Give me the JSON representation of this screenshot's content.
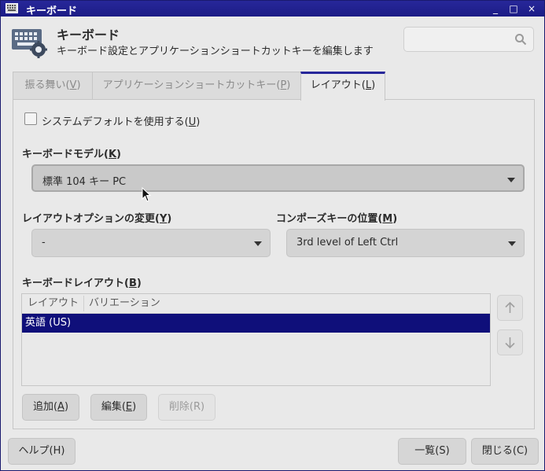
{
  "window": {
    "title": "キーボード",
    "buttons": [
      "_",
      "□",
      "×"
    ]
  },
  "header": {
    "title": "キーボード",
    "subtitle": "キーボード設定とアプリケーションショートカットキーを編集します",
    "icon": "keyboard-settings-icon"
  },
  "search": {
    "placeholder": ""
  },
  "tabs": [
    {
      "label": "振る舞い(",
      "mnemonic": "V",
      "tail": ")"
    },
    {
      "label": "アプリケーションショートカットキー(",
      "mnemonic": "P",
      "tail": ")"
    },
    {
      "label": "レイアウト(",
      "mnemonic": "L",
      "tail": ")"
    }
  ],
  "active_tab": 2,
  "system_default": {
    "label": "システムデフォルトを使用する(",
    "mnemonic": "U",
    "tail": ")",
    "checked": false
  },
  "keyboard_model": {
    "label": "キーボードモデル(",
    "mnemonic": "K",
    "tail": ")",
    "value": "標準 104 キー PC"
  },
  "layout_option": {
    "label": "レイアウトオプションの変更(",
    "mnemonic": "Y",
    "tail": ")",
    "value": "-"
  },
  "compose_key": {
    "label": "コンポーズキーの位置(",
    "mnemonic": "M",
    "tail": ")",
    "value": "3rd level of Left Ctrl"
  },
  "keyboard_layout": {
    "label": "キーボードレイアウト(",
    "mnemonic": "B",
    "tail": ")",
    "columns": [
      "レイアウト",
      "バリエーション"
    ],
    "rows": [
      {
        "layout": "英語 (US)",
        "variation": "",
        "selected": true
      }
    ]
  },
  "list_buttons": {
    "add": {
      "label": "追加(",
      "mnemonic": "A",
      "tail": ")"
    },
    "edit": {
      "label": "編集(",
      "mnemonic": "E",
      "tail": ")"
    },
    "remove": {
      "label": "削除(R)"
    }
  },
  "footer": {
    "help": "ヘルプ(H)",
    "list": "一覧(S)",
    "close": "閉じる(C)"
  },
  "colors": {
    "titlebar": "#1c1c86",
    "selection": "#0f0f7a",
    "accent_tab": "#27279a"
  }
}
